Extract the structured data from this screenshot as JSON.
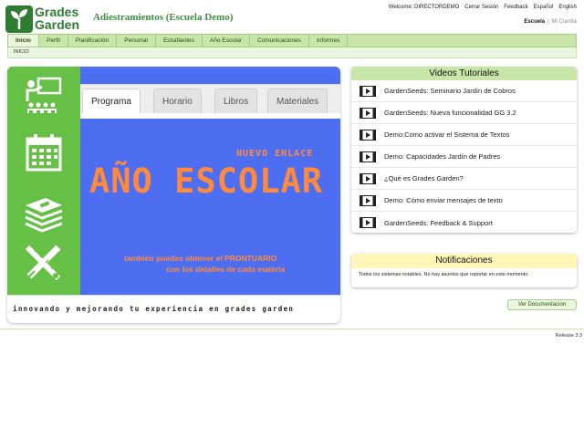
{
  "logo": {
    "line1": "Grades",
    "line2": "Garden"
  },
  "app_title": "Adiestramientos (Escuela Demo)",
  "top_links": {
    "welcome": "Welcome: DIRECTORDEMO",
    "logout": "Cerrar Sesión",
    "feedback": "Feedback",
    "spanish": "Español",
    "english": "English"
  },
  "account_links": {
    "school": "Escuela",
    "separator": "|",
    "my_account": "Mi Cuenta"
  },
  "nav": {
    "tabs": [
      "Inicio",
      "Perfil",
      "Planificación",
      "Personal",
      "Estudiantes",
      "Año Escolar",
      "Comunicaciones",
      "Informes"
    ],
    "active_index": 0
  },
  "breadcrumb": "INICIO",
  "banner": {
    "tabs": [
      "Programa",
      "Horario",
      "Libros",
      "Materiales"
    ],
    "active_tab": 0,
    "kicker": "NUEVO ENLACE",
    "headline": "AÑO ESCOLAR",
    "line1": "también puedes obtener el PRONTUARIO",
    "line2": "con los detalles de cada materia",
    "footer": "innovando y mejorando tu experiencia en grades garden",
    "colors": {
      "side": "#66c045",
      "main": "#4e6ef2",
      "accent": "#ff8a3d"
    }
  },
  "videos": {
    "title": "Videos Tutoriales",
    "items": [
      "GardenSeeds: Seminario Jardín de Cobros",
      "GardenSeeds: Nueva funcionalidad GG 3.2",
      "Demo:Como activar el Sistema de Textos",
      "Demo: Capacidades Jardín de Padres",
      "¿Qué es Grades Garden?",
      "Demo: Cómo enviar mensajes de texto",
      "GardenSeeds: Feedback & Support"
    ]
  },
  "notifications": {
    "title": "Notificaciones",
    "text": "Todos los sistemas estables. No hay asuntos que reportar en este momento."
  },
  "doc_button": "Ver Documentacion",
  "release": "Release 3.3"
}
